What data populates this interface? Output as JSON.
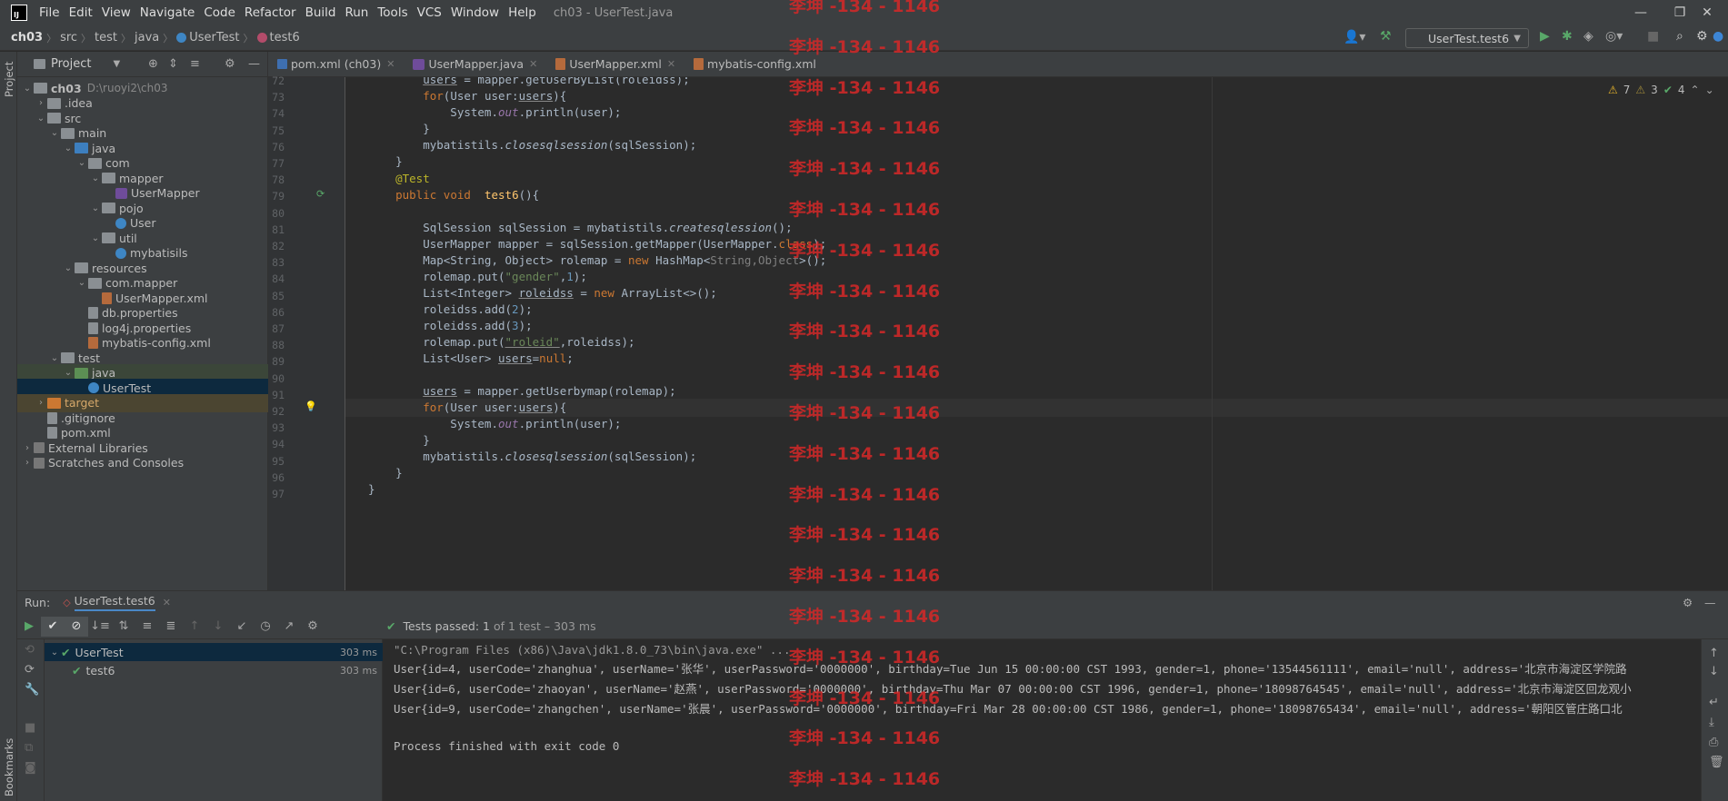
{
  "menu": [
    "File",
    "Edit",
    "View",
    "Navigate",
    "Code",
    "Refactor",
    "Build",
    "Run",
    "Tools",
    "VCS",
    "Window",
    "Help"
  ],
  "window_title": "ch03 - UserTest.java",
  "breadcrumbs": [
    "ch03",
    "src",
    "test",
    "java",
    "UserTest",
    "test6"
  ],
  "run_config": "UserTest.test6",
  "project_panel": {
    "title": "Project",
    "tree": [
      {
        "label": "ch03",
        "path": "D:\\ruoyi2\\ch03",
        "depth": 0,
        "icon": "folder-icon"
      },
      {
        "label": ".idea",
        "depth": 1,
        "icon": "folder-icon"
      },
      {
        "label": "src",
        "depth": 1,
        "icon": "folder-icon"
      },
      {
        "label": "main",
        "depth": 2,
        "icon": "folder-icon"
      },
      {
        "label": "java",
        "depth": 3,
        "icon": "source-folder-icon"
      },
      {
        "label": "com",
        "depth": 4,
        "icon": "package-icon"
      },
      {
        "label": "mapper",
        "depth": 5,
        "icon": "package-icon"
      },
      {
        "label": "UserMapper",
        "depth": 6,
        "icon": "interface-icon"
      },
      {
        "label": "pojo",
        "depth": 5,
        "icon": "package-icon"
      },
      {
        "label": "User",
        "depth": 6,
        "icon": "class-icon"
      },
      {
        "label": "util",
        "depth": 5,
        "icon": "package-icon"
      },
      {
        "label": "mybatisils",
        "depth": 6,
        "icon": "class-icon"
      },
      {
        "label": "resources",
        "depth": 3,
        "icon": "resources-folder-icon"
      },
      {
        "label": "com.mapper",
        "depth": 4,
        "icon": "package-icon"
      },
      {
        "label": "UserMapper.xml",
        "depth": 5,
        "icon": "xml-file-icon"
      },
      {
        "label": "db.properties",
        "depth": 4,
        "icon": "properties-file-icon"
      },
      {
        "label": "log4j.properties",
        "depth": 4,
        "icon": "properties-file-icon"
      },
      {
        "label": "mybatis-config.xml",
        "depth": 4,
        "icon": "xml-file-icon"
      },
      {
        "label": "test",
        "depth": 2,
        "icon": "folder-icon"
      },
      {
        "label": "java",
        "depth": 3,
        "icon": "test-folder-icon"
      },
      {
        "label": "UserTest",
        "depth": 4,
        "icon": "class-icon"
      },
      {
        "label": "target",
        "depth": 1,
        "icon": "excluded-folder-icon"
      },
      {
        "label": ".gitignore",
        "depth": 1,
        "icon": "file-icon"
      },
      {
        "label": "pom.xml",
        "depth": 1,
        "icon": "maven-file-icon"
      },
      {
        "label": "External Libraries",
        "depth": 0,
        "icon": "library-icon"
      },
      {
        "label": "Scratches and Consoles",
        "depth": 0,
        "icon": "scratches-icon"
      }
    ]
  },
  "editor_tabs": [
    {
      "label": "pom.xml (ch03)"
    },
    {
      "label": "UserMapper.java"
    },
    {
      "label": "UserMapper.xml"
    },
    {
      "label": "mybatis-config.xml"
    }
  ],
  "inspection": {
    "warnings": "7",
    "weak_warnings": "3",
    "ok": "4"
  },
  "line_numbers": [
    "72",
    "73",
    "74",
    "75",
    "76",
    "77",
    "78",
    "79",
    "80",
    "81",
    "82",
    "83",
    "84",
    "85",
    "86",
    "87",
    "88",
    "89",
    "90",
    "91",
    "92",
    "93",
    "94",
    "95",
    "96",
    "97"
  ],
  "run_panel": {
    "label": "Run:",
    "tab": "UserTest.test6",
    "tests_passed_bold": "Tests passed: 1",
    "tests_passed_rest": "of 1 test – 303 ms",
    "tests": [
      {
        "name": "UserTest",
        "time": "303 ms"
      },
      {
        "name": "test6",
        "time": "303 ms"
      }
    ],
    "console": [
      "\"C:\\Program Files (x86)\\Java\\jdk1.8.0_73\\bin\\java.exe\" ...",
      "User{id=4, userCode='zhanghua', userName='张华', userPassword='0000000', birthday=Tue Jun 15 00:00:00 CST 1993, gender=1, phone='13544561111', email='null', address='北京市海淀区学院路",
      "User{id=6, userCode='zhaoyan', userName='赵燕', userPassword='0000000', birthday=Thu Mar 07 00:00:00 CST 1996, gender=1, phone='18098764545', email='null', address='北京市海淀区回龙观小",
      "User{id=9, userCode='zhangchen', userName='张晨', userPassword='0000000', birthday=Fri Mar 28 00:00:00 CST 1986, gender=1, phone='18098765434', email='null', address='朝阳区管庄路口北",
      "",
      "Process finished with exit code 0"
    ]
  },
  "watermark": "李坤 -134 - 1146",
  "colors": {
    "accent": "#4a88c7",
    "keyword": "#cc7832",
    "string": "#6a8759",
    "pass": "#59a869",
    "watermark": "#d62828"
  }
}
